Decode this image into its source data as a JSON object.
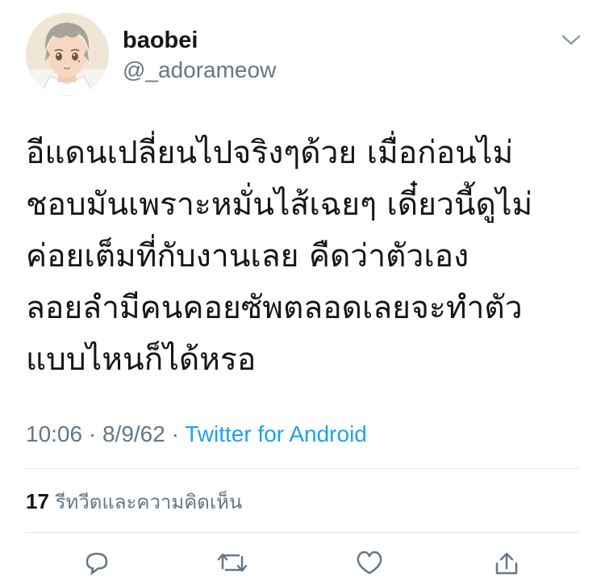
{
  "tweet": {
    "user": {
      "display_name": "baobei",
      "handle": "@_adorameow"
    },
    "text_lines": [
      "อีแดนเปลี่ยนไปจริงๆด้วย เมื่อก่อนไม่",
      "ชอบมันเพราะหมั่นไส้เฉยๆ เดี๋ยวนี้ดูไม่",
      "ค่อยเต็มที่กับงานเลย คืดว่าตัวเอง",
      "ลอยลำมีคนคอยซัพตลอดเลยจะทำตัว",
      "แบบไหนก็ได้หรอ"
    ],
    "time": "10:06",
    "date": "8/9/62",
    "separator": "·",
    "source": "Twitter for Android",
    "retweet_count": "17",
    "retweet_label": "รีทวีตและความคิดเห็น"
  },
  "icons": {
    "menu": "chevron-down-icon",
    "actions": [
      "reply-icon",
      "retweet-icon",
      "like-icon",
      "share-icon"
    ]
  },
  "colors": {
    "text": "#14171a",
    "secondary": "#657786",
    "link": "#1da1f2",
    "divider": "#e1e8ed"
  }
}
